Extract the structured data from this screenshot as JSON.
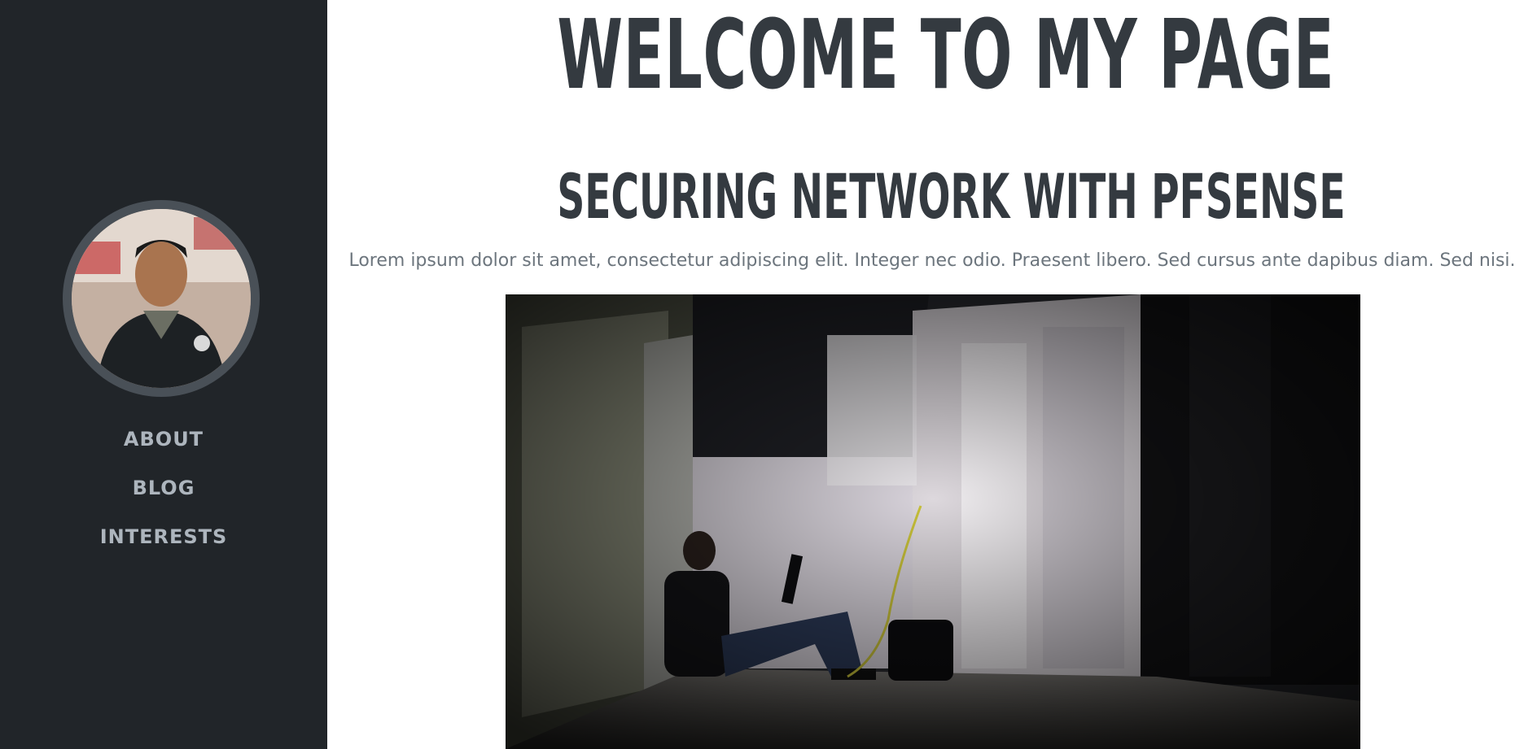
{
  "sidebar": {
    "avatar_alt": "profile photo",
    "nav": [
      {
        "label": "ABOUT"
      },
      {
        "label": "BLOG"
      },
      {
        "label": "INTERESTS"
      }
    ]
  },
  "main": {
    "heading": "WELCOME TO MY PAGE",
    "post": {
      "title": "SECURING NETWORK WITH PFSENSE",
      "text": "Lorem ipsum dolor sit amet, consectetur adipiscing elit. Integer nec odio. Praesent libero. Sed cursus ante dapibus diam. Sed nisi.",
      "image_alt": "person with laptop in server room"
    }
  },
  "colors": {
    "sidebar_bg": "#212529",
    "heading": "#343a40",
    "nav_text": "#adb5bd",
    "body_text": "#6c757d"
  }
}
